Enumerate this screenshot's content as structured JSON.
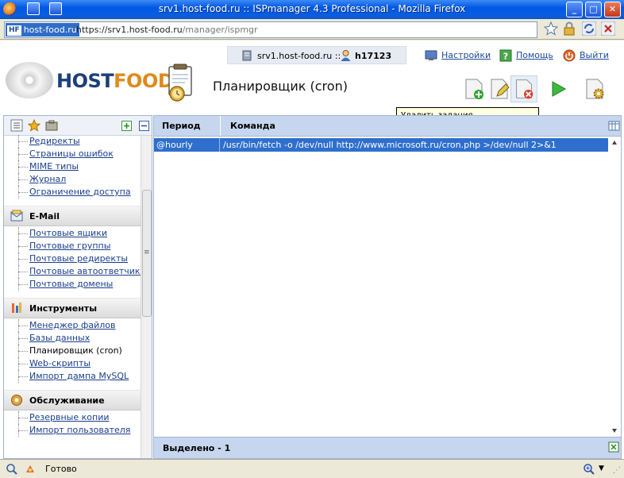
{
  "window": {
    "title": "srv1.host-food.ru :: ISPmanager 4.3 Professional - Mozilla Firefox"
  },
  "address_bar": {
    "site_identity": "host-food.ru",
    "url_scheme": "https://srv1.",
    "url_host": "host-food.ru",
    "url_path": "/manager/ispmgr"
  },
  "header": {
    "server": "srv1.host-food.ru ::",
    "user": "h17123",
    "nav": {
      "settings": "Настройки",
      "help": "Помощь",
      "logout": "Выйти"
    },
    "logo_host": "HOST",
    "logo_food": "FOOD",
    "page_title": "Планировщик (cron)",
    "tooltip": "Удалить задания"
  },
  "sidebar": {
    "top_items": [
      "Редиректы",
      "Страницы ошибок",
      "MIME типы",
      "Журнал",
      "Ограничение доступа"
    ],
    "email": {
      "title": "E-Mail",
      "items": [
        "Почтовые ящики",
        "Почтовые группы",
        "Почтовые редиректы",
        "Почтовые автоответчики",
        "Почтовые домены"
      ]
    },
    "tools": {
      "title": "Инструменты",
      "items": [
        "Менеджер файлов",
        "Базы данных",
        "Планировщик (cron)",
        "Web-скрипты",
        "Импорт дампа MySQL"
      ]
    },
    "service": {
      "title": "Обслуживание",
      "items": [
        "Резервные копии",
        "Импорт пользователя"
      ]
    }
  },
  "grid": {
    "columns": [
      "Период",
      "Команда"
    ],
    "rows": [
      {
        "period": "@hourly",
        "command": "/usr/bin/fetch -o /dev/null http://www.microsoft.ru/cron.php >/dev/null 2>&1"
      }
    ],
    "footer": "Выделено - 1"
  },
  "statusbar": {
    "text": "Готово"
  },
  "colors": {
    "selection": "#2e6fce",
    "grid_header": "#c6d6ee",
    "link": "#1a3f8c"
  }
}
